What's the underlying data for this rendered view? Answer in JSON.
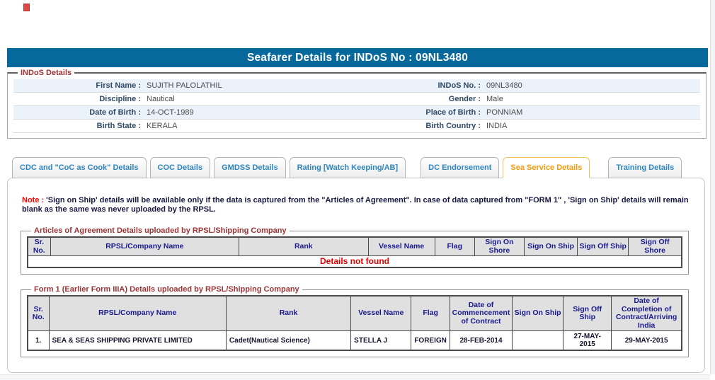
{
  "colors": {
    "titlebar_blue": "#07689B",
    "legend_maroon": "#9C3335",
    "tab_blue": "#2F85BC",
    "tab_active_orange": "#F29A0E",
    "error_red": "#E00000",
    "row_alt_blue": "#EBF2FA"
  },
  "icons": {
    "broken_image": "broken-image-icon"
  },
  "header": {
    "title": "Seafarer Details for INDoS No : 09NL3480"
  },
  "indos": {
    "legend": "INDoS Details",
    "rows": [
      {
        "l1": "First Name :",
        "v1": "SUJITH PALOLATHIL",
        "l2": "INDoS No. :",
        "v2": "09NL3480"
      },
      {
        "l1": "Discipline :",
        "v1": "Nautical",
        "l2": "Gender :",
        "v2": "Male"
      },
      {
        "l1": "Date of Birth :",
        "v1": "14-OCT-1989",
        "l2": "Place of Birth :",
        "v2": "PONNIAM"
      },
      {
        "l1": "Birth State :",
        "v1": "KERALA",
        "l2": "Birth Country :",
        "v2": "INDIA"
      }
    ]
  },
  "tabs": [
    {
      "label": "CDC and \"CoC as Cook\" Details",
      "active": false
    },
    {
      "label": "COC Details",
      "active": false
    },
    {
      "label": "GMDSS Details",
      "active": false
    },
    {
      "label": "Rating [Watch Keeping/AB]",
      "active": false
    },
    {
      "label": "DC Endorsement",
      "active": false
    },
    {
      "label": "Sea Service Details",
      "active": true
    },
    {
      "label": "Training Details",
      "active": false
    }
  ],
  "note": {
    "label": "Note :",
    "text": "'Sign on Ship' details will be available only if the data is captured from the \"Articles of Agreement\". In case of data captured from \"FORM 1\" , 'Sign on Ship' details will remain blank as the same was never uploaded by the RPSL."
  },
  "articles": {
    "legend": "Articles of Agreement Details uploaded by RPSL/Shipping Company",
    "columns": [
      "Sr. No.",
      "RPSL/Company Name",
      "Rank",
      "Vessel Name",
      "Flag",
      "Sign On Shore",
      "Sign On Ship",
      "Sign Off Ship",
      "Sign Off Shore"
    ],
    "empty_message": "Details not found"
  },
  "form1": {
    "legend": "Form 1 (Earlier Form IIIA) Details uploaded by RPSL/Shipping Company",
    "columns": [
      "Sr. No.",
      "RPSL/Company Name",
      "Rank",
      "Vessel Name",
      "Flag",
      "Date of Commencement of Contract",
      "Sign On Ship",
      "Sign Off Ship",
      "Date of Completion of Contract/Arriving India"
    ],
    "rows": [
      {
        "sr": "1.",
        "company": "SEA & SEAS SHIPPING PRIVATE LIMITED",
        "rank": "Cadet(Nautical Science)",
        "vessel": "STELLA J",
        "flag": "FOREIGN",
        "commencement": "28-FEB-2014",
        "sign_on_ship": "",
        "sign_off_ship": "27-MAY-2015",
        "completion": "29-MAY-2015"
      }
    ]
  }
}
